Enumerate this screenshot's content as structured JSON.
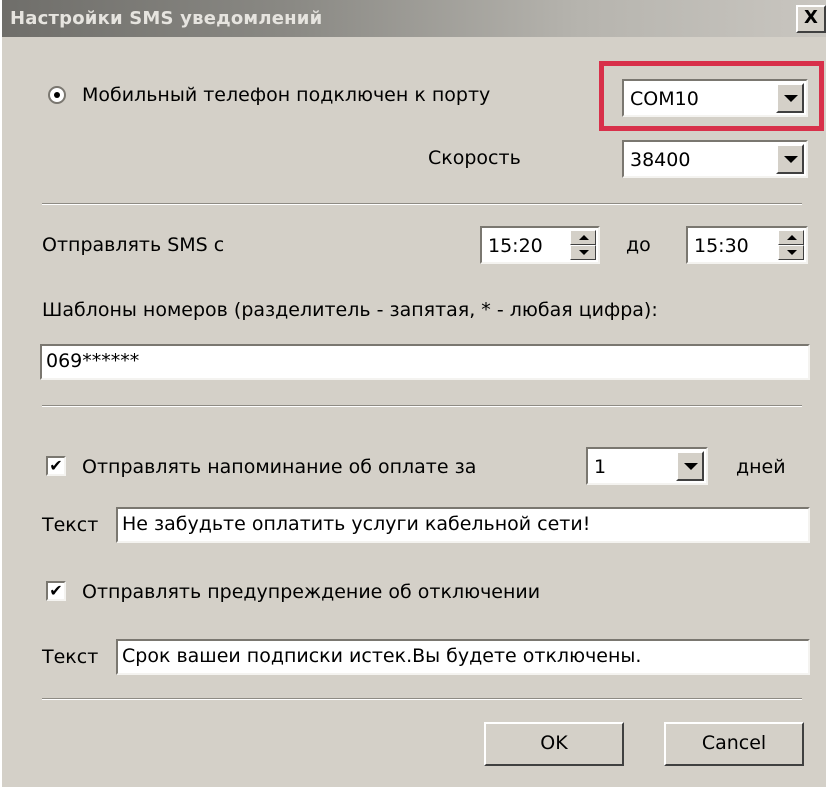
{
  "window": {
    "title": "Настройки SMS уведомлений",
    "close_glyph": "X"
  },
  "port": {
    "label": "Мобильный телефон подключен к порту",
    "value": "COM10",
    "selected": true
  },
  "speed": {
    "label": "Скорость",
    "value": "38400"
  },
  "schedule": {
    "label": "Отправлять SMS с",
    "from": "15:20",
    "to_label": "до",
    "to": "15:30"
  },
  "templates": {
    "label": "Шаблоны номеров (разделитель - запятая, * - любая цифра):",
    "value": "069******"
  },
  "reminder": {
    "checked": true,
    "check_glyph": "✔",
    "label": "Отправлять напоминание об оплате за",
    "days_value": "1",
    "days_label": "дней",
    "text_label": "Текст",
    "text_value": "Не забудьте оплатить услуги кабельной сети!"
  },
  "warning": {
    "checked": true,
    "check_glyph": "✔",
    "label": "Отправлять предупреждение об отключении",
    "text_label": "Текст",
    "text_value": "Срок вашеи подписки истек.Вы будете отключены."
  },
  "buttons": {
    "ok": "OK",
    "cancel": "Cancel"
  },
  "colors": {
    "highlight": "#d8304a",
    "face": "#d4d0c8"
  }
}
